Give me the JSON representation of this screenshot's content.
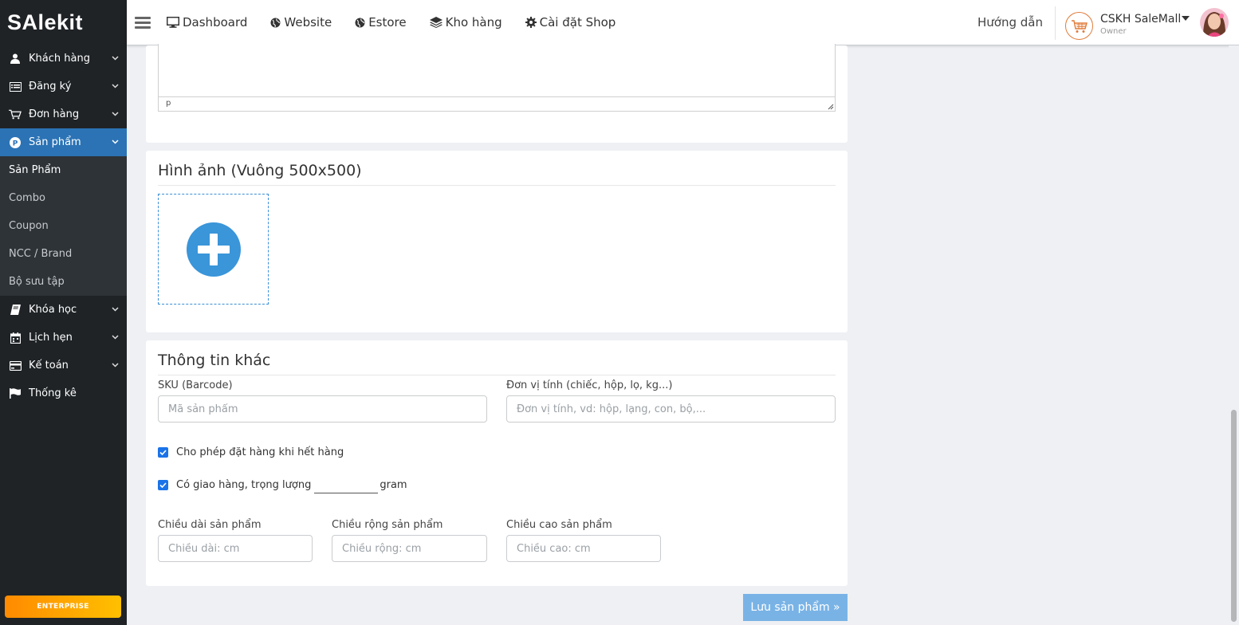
{
  "brand": {
    "logo_text": "SAlekit"
  },
  "sidebar": {
    "items": [
      {
        "label": "Khách hàng",
        "icon": "user-icon"
      },
      {
        "label": "Đăng ký",
        "icon": "list-icon"
      },
      {
        "label": "Đơn hàng",
        "icon": "cart-icon"
      },
      {
        "label": "Sản phẩm",
        "icon": "product-p-icon",
        "active": true
      },
      {
        "label": "Khóa học",
        "icon": "book-icon"
      },
      {
        "label": "Lịch hẹn",
        "icon": "calendar-icon"
      },
      {
        "label": "Kế toán",
        "icon": "credit-card-icon"
      },
      {
        "label": "Thống kê",
        "icon": "flag-icon"
      }
    ],
    "submenu": [
      {
        "label": "Sản Phẩm",
        "current": true
      },
      {
        "label": "Combo"
      },
      {
        "label": "Coupon"
      },
      {
        "label": "NCC / Brand"
      },
      {
        "label": "Bộ sưu tập"
      }
    ],
    "plan_badge": "ENTERPRISE"
  },
  "topbar": {
    "nav": [
      {
        "label": "Dashboard",
        "icon": "monitor-icon"
      },
      {
        "label": "Website",
        "icon": "globe-icon"
      },
      {
        "label": "Estore",
        "icon": "globe-icon"
      },
      {
        "label": "Kho hàng",
        "icon": "stack-icon"
      },
      {
        "label": "Cài đặt Shop",
        "icon": "gear-icon"
      }
    ],
    "guide_label": "Hướng dẫn",
    "shop_name": "CSKH SaleMall",
    "shop_role": "Owner"
  },
  "editor": {
    "status_path": "p"
  },
  "images_section": {
    "title": "Hình ảnh (Vuông 500x500)"
  },
  "other_info": {
    "title": "Thông tin khác",
    "sku_label": "SKU (Barcode)",
    "sku_placeholder": "Mã sản phẩm",
    "unit_label": "Đơn vị tính (chiếc, hộp, lọ, kg...)",
    "unit_placeholder": "Đơn vị tính, vd: hộp, lạng, con, bộ,...",
    "allow_backorder_label": "Cho phép đặt hàng khi hết hàng",
    "shipping_label": "Có giao hàng, trọng lượng",
    "weight_unit": "gram",
    "length_label": "Chiều dài sản phẩm",
    "length_placeholder": "Chiều dài: cm",
    "width_label": "Chiều rộng sản phẩm",
    "width_placeholder": "Chiều rộng: cm",
    "height_label": "Chiều cao sản phẩm",
    "height_placeholder": "Chiều cao: cm"
  },
  "save_button_label": "Lưu sản phẩm »",
  "colors": {
    "sidebar_bg": "#1f2326",
    "active_blue": "#2b73b5",
    "save_blue": "#79b3e6",
    "enterprise_orange": "#ff8a00"
  }
}
